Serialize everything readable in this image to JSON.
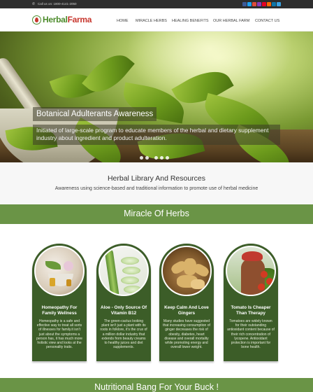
{
  "topbar": {
    "phone_text": "Call us on: 1800-4141-2050",
    "social_colors": [
      "#3b5998",
      "#1da1f2",
      "#dd4b39",
      "#8a3ab9",
      "#e60023",
      "#ff6600",
      "#0e76a8",
      "#3aa3e3"
    ]
  },
  "header": {
    "logo_part1": "Herbal",
    "logo_part2": "Farma",
    "nav": [
      "HOME",
      "MIRACLE HERBS",
      "HEALING BENEFITS",
      "OUR HERBAL FARM",
      "CONTACT US"
    ]
  },
  "hero": {
    "title": "Botanical Adulterants Awareness",
    "description": "Initiated of large-scale program to educate members of the herbal and dietary supplement industry about ingredient and product adulteration."
  },
  "library": {
    "title": "Herbal Library And Resources",
    "subtitle": "Awareness using science-based and traditional information to promote use of herbal medicine"
  },
  "miracle": {
    "title": "Miracle Of Herbs",
    "cards": [
      {
        "title": "Homeopathy For Family Wellness",
        "text": "Homeopathy is a safe and effective way to treat all sorts of illnesses for family.it isn't just about the symptoms a person has, it has much more holistic view and looks at the personality traits."
      },
      {
        "title": "Aloe - Only Source Of Vitamin B12",
        "text": "The green-cactus looking plant isn't just a plant with its roots in folklore, it's the crux of a million dollar industry that extends from beauty creams to healthy juices and diet supplements."
      },
      {
        "title": "Keep Calm And Love Gingers",
        "text": "Many studies have suggested that increasing consumption of ginger decreases the risk of obesity, diabetes, heart disease and overall mortality while promoting energy and overall lower weight."
      },
      {
        "title": "Tomato Is Cheaper Than Therapy",
        "text": "Tomatoes are widely known for their outstanding antioxidant content because of their rich concentration of lycopene. Antioxidant protection is important for bone health."
      }
    ]
  },
  "bottom": {
    "title": "Nutritional Bang For Your Buck !"
  },
  "colors": {
    "brand_green": "#6a9446",
    "card_green": "#3c5d28",
    "brand_red": "#c7362d"
  }
}
